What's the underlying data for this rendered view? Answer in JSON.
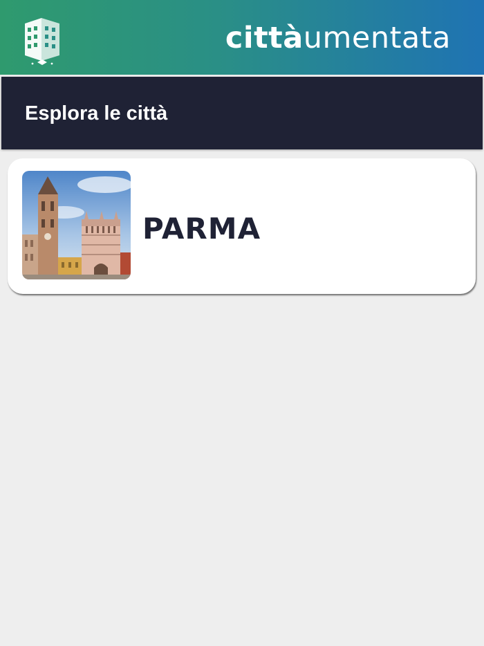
{
  "header": {
    "brand_bold": "città",
    "brand_light": "umentata",
    "logo_icon": "building-logo-icon"
  },
  "section": {
    "title": "Esplora le città"
  },
  "cities": [
    {
      "name": "PARMA",
      "thumbnail_icon": "parma-cathedral-photo"
    }
  ],
  "colors": {
    "header_gradient_start": "#2f9a6e",
    "header_gradient_end": "#1f73b3",
    "section_bg": "#1f2235",
    "page_bg": "#eeeeee",
    "card_bg": "#ffffff",
    "city_text": "#1f2235"
  }
}
